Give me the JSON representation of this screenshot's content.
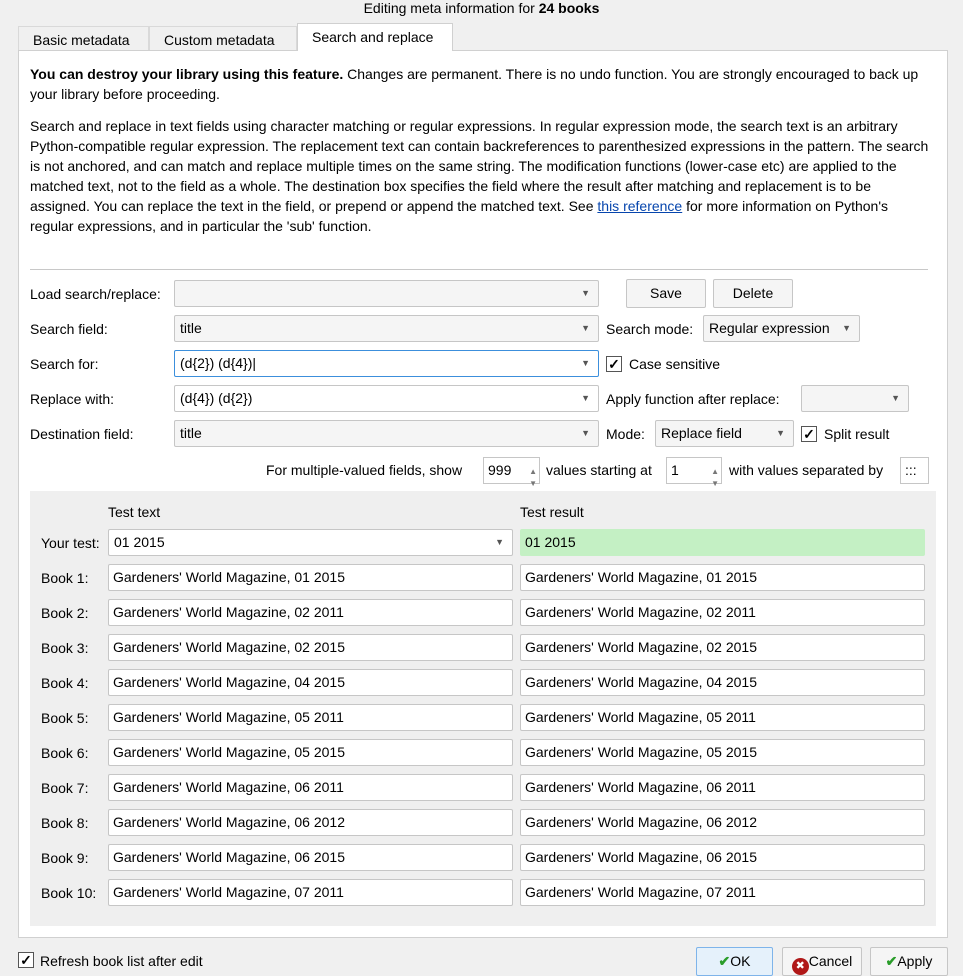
{
  "window": {
    "title_prefix": "Editing meta information for ",
    "title_bold": "24 books"
  },
  "tabs": [
    {
      "label": "Basic metadata"
    },
    {
      "label": "Custom metadata"
    },
    {
      "label": "Search and replace",
      "active": true
    }
  ],
  "warning": {
    "bold": "You can destroy your library using this feature.",
    "rest": " Changes are permanent. There is no undo function. You are strongly encouraged to back up your library before proceeding."
  },
  "description": {
    "text": "Search and replace in text fields using character matching or regular expressions. In regular expression mode, the search text is an arbitrary Python-compatible regular expression. The replacement text can contain backreferences to parenthesized expressions in the pattern. The search is not anchored, and can match and replace multiple times on the same string. The modification functions (lower-case etc) are applied to the matched text, not to the field as a whole. The destination box specifies the field where the result after matching and replacement is to be assigned. You can replace the text in the field, or prepend or append the matched text. See ",
    "link": "this reference",
    "after": " for more information on Python's regular expressions, and in particular the 'sub' function."
  },
  "form": {
    "load_label": "Load search/replace:",
    "load_value": "",
    "save": "Save",
    "delete": "Delete",
    "search_field_label": "Search field:",
    "search_field_value": "title",
    "search_mode_label": "Search mode:",
    "search_mode_value": "Regular expression",
    "search_for_label": "Search for:",
    "search_for_value": "(d{2}) (d{4})",
    "case_sensitive_label": "Case sensitive",
    "case_sensitive": true,
    "replace_label": "Replace with:",
    "replace_value": "(d{4}) (d{2})",
    "apply_function_label": "Apply function after replace:",
    "apply_function_value": "",
    "dest_label": "Destination field:",
    "dest_value": "title",
    "mode_label": "Mode:",
    "mode_value": "Replace field",
    "split_label": "Split result",
    "split": true,
    "multi_label": "For multiple-valued fields, show",
    "multi_show": "999",
    "starting_label": "values starting at",
    "starting_value": "1",
    "separated_label": "with values separated by",
    "separator": ":::"
  },
  "test": {
    "text_header": "Test text",
    "result_header": "Test result",
    "your_test_label": "Your test:",
    "your_test_value": "01 2015",
    "your_test_result": "01 2015",
    "result_ok_color": "#c4f0c4",
    "books": [
      {
        "label": "Book 1:",
        "text": "Gardeners' World Magazine, 01 2015",
        "result": "Gardeners' World Magazine, 01 2015"
      },
      {
        "label": "Book 2:",
        "text": "Gardeners' World Magazine, 02 2011",
        "result": "Gardeners' World Magazine, 02 2011"
      },
      {
        "label": "Book 3:",
        "text": "Gardeners' World Magazine, 02 2015",
        "result": "Gardeners' World Magazine, 02 2015"
      },
      {
        "label": "Book 4:",
        "text": "Gardeners' World Magazine, 04 2015",
        "result": "Gardeners' World Magazine, 04 2015"
      },
      {
        "label": "Book 5:",
        "text": "Gardeners' World Magazine, 05 2011",
        "result": "Gardeners' World Magazine, 05 2011"
      },
      {
        "label": "Book 6:",
        "text": "Gardeners' World Magazine, 05 2015",
        "result": "Gardeners' World Magazine, 05 2015"
      },
      {
        "label": "Book 7:",
        "text": "Gardeners' World Magazine, 06 2011",
        "result": "Gardeners' World Magazine, 06 2011"
      },
      {
        "label": "Book 8:",
        "text": "Gardeners' World Magazine, 06 2012",
        "result": "Gardeners' World Magazine, 06 2012"
      },
      {
        "label": "Book 9:",
        "text": "Gardeners' World Magazine, 06 2015",
        "result": "Gardeners' World Magazine, 06 2015"
      },
      {
        "label": "Book 10:",
        "text": "Gardeners' World Magazine, 07 2011",
        "result": "Gardeners' World Magazine, 07 2011"
      }
    ]
  },
  "footer": {
    "refresh_label": "Refresh book list after edit",
    "refresh": true,
    "ok": "OK",
    "cancel": "Cancel",
    "apply": "Apply"
  }
}
